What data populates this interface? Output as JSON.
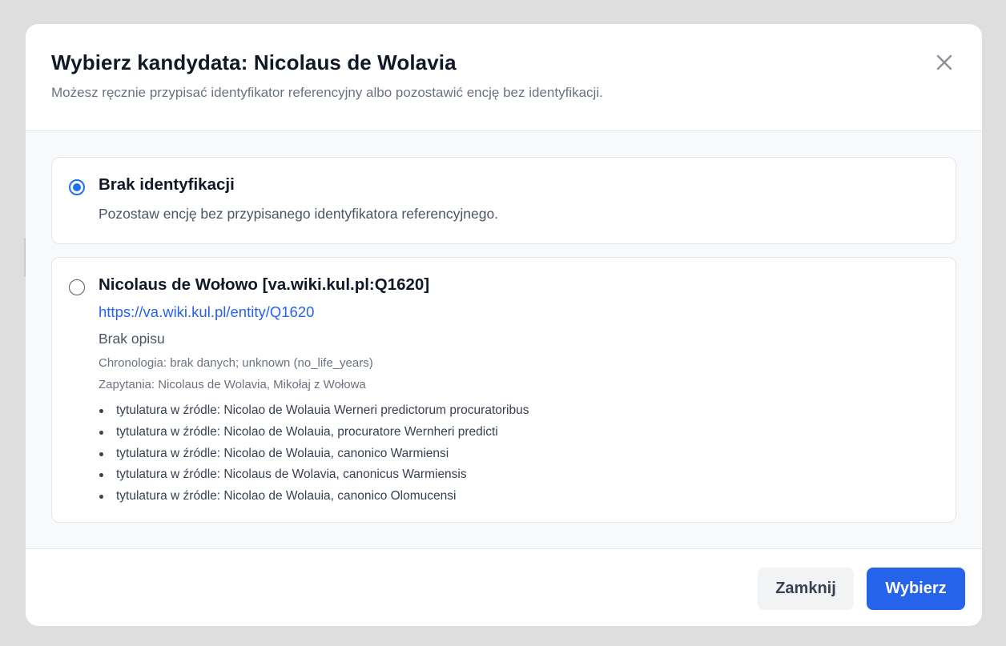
{
  "dialog": {
    "title": "Wybierz kandydata: Nicolaus de Wolavia",
    "subtitle": "Możesz ręcznie przypisać identyfikator referencyjny albo pozostawić encję bez identyfikacji.",
    "close_icon": "close-icon"
  },
  "options": {
    "none": {
      "title": "Brak identyfikacji",
      "description": "Pozostaw encję bez przypisanego identyfikatora referencyjnego.",
      "selected": true
    },
    "candidate": {
      "title": "Nicolaus de Wołowo [va.wiki.kul.pl:Q1620]",
      "url": "https://va.wiki.kul.pl/entity/Q1620",
      "description": "Brak opisu",
      "chronology": "Chronologia: brak danych; unknown (no_life_years)",
      "queries": "Zapytania: Nicolaus de Wolavia, Mikołaj z Wołowa",
      "titles": [
        "tytulatura w źródle: Nicolao de Wolauia Werneri predictorum procuratoribus",
        "tytulatura w źródle: Nicolao de Wolauia, procuratore Wernheri predicti",
        "tytulatura w źródle: Nicolao de Wolauia, canonico Warmiensi",
        "tytulatura w źródle: Nicolaus de Wolavia, canonicus Warmiensis",
        "tytulatura w źródle: Nicolao de Wolauia, canonico Olomucensi"
      ],
      "selected": false
    }
  },
  "footer": {
    "close_label": "Zamknij",
    "select_label": "Wybierz"
  },
  "colors": {
    "accent": "#2563eb",
    "radio": "#1a73e8",
    "backdrop": "#dedede"
  }
}
